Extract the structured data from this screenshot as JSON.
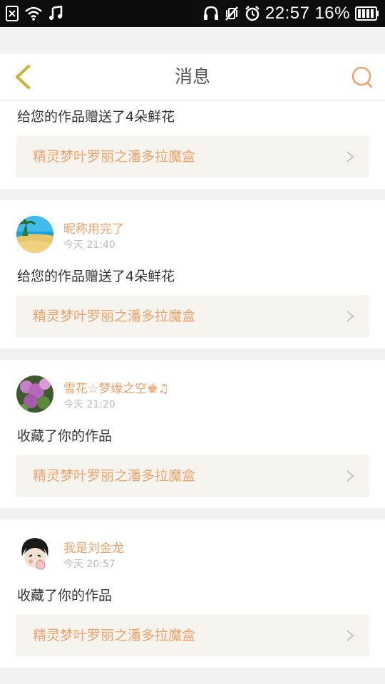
{
  "status_bar": {
    "time": "22:57",
    "battery_percent": "16%",
    "icons": [
      "sim-none-icon",
      "wifi-icon",
      "music-note-icon",
      "headphones-icon",
      "vibrate-off-icon",
      "alarm-clock-icon",
      "battery-icon"
    ]
  },
  "nav": {
    "title": "消息",
    "back_icon": "chevron-left-icon",
    "search_icon": "search-icon"
  },
  "colors": {
    "accent_orange": "#f0a26a",
    "back_icon": "#c8b53a",
    "work_bg": "#f5f4ef"
  },
  "messages": [
    {
      "action": "给您的作品赠送了4朵鲜花",
      "work_title": "精灵梦叶罗丽之潘多拉魔盒"
    },
    {
      "username": "昵称用完了",
      "time": "今天 21:40",
      "action": "给您的作品赠送了4朵鲜花",
      "work_title": "精灵梦叶罗丽之潘多拉魔盒"
    },
    {
      "username": "雪花☆梦缘之空♚♫",
      "time": "今天 21:20",
      "action": "收藏了你的作品",
      "work_title": "精灵梦叶罗丽之潘多拉魔盒"
    },
    {
      "username": "我是刘金龙",
      "time": "今天 20:57",
      "action": "收藏了你的作品",
      "work_title": "精灵梦叶罗丽之潘多拉魔盒"
    }
  ]
}
